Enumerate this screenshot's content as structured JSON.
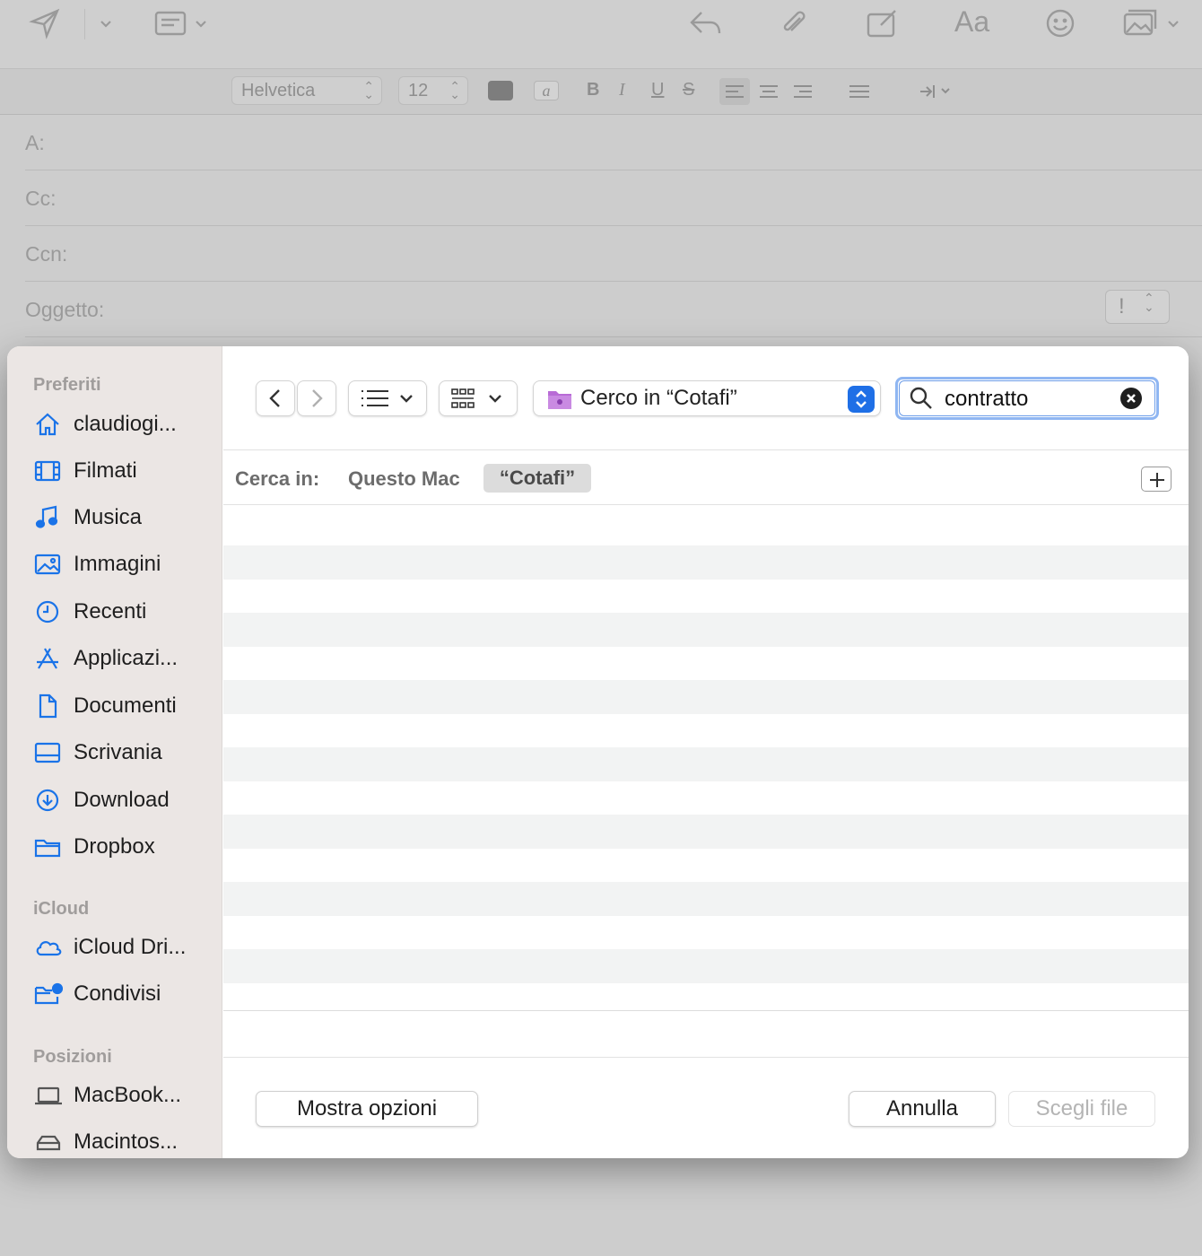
{
  "mail": {
    "toolbar": {
      "icons": [
        "send-icon",
        "chevron-down-icon",
        "header-fields-icon",
        "reply-icon",
        "attachment-icon",
        "markup-icon",
        "font-icon",
        "emoji-icon",
        "photo-browser-icon"
      ],
      "font_label": "Aa"
    },
    "format_bar": {
      "font_name": "Helvetica",
      "font_size": "12",
      "bold": "B",
      "italic": "I",
      "underline": "U",
      "strike": "S",
      "bg_color_glyph": "a"
    },
    "fields": {
      "to_label": "A:",
      "cc_label": "Cc:",
      "bcc_label": "Ccn:",
      "subject_label": "Oggetto:",
      "priority_glyph": "!"
    }
  },
  "dialog": {
    "sidebar": {
      "favorites_title": "Preferiti",
      "favorites": [
        {
          "label": "claudiogi...",
          "icon": "home-icon"
        },
        {
          "label": "Filmati",
          "icon": "film-icon"
        },
        {
          "label": "Musica",
          "icon": "music-note-icon"
        },
        {
          "label": "Immagini",
          "icon": "photo-icon"
        },
        {
          "label": "Recenti",
          "icon": "clock-icon"
        },
        {
          "label": "Applicazi...",
          "icon": "apps-icon"
        },
        {
          "label": "Documenti",
          "icon": "document-icon"
        },
        {
          "label": "Scrivania",
          "icon": "desktop-icon"
        },
        {
          "label": "Download",
          "icon": "download-icon"
        },
        {
          "label": "Dropbox",
          "icon": "folder-icon"
        }
      ],
      "icloud_title": "iCloud",
      "icloud": [
        {
          "label": "iCloud Dri...",
          "icon": "cloud-icon"
        },
        {
          "label": "Condivisi",
          "icon": "shared-folder-icon"
        }
      ],
      "locations_title": "Posizioni",
      "locations": [
        {
          "label": "MacBook...",
          "icon": "laptop-icon"
        },
        {
          "label": "Macintos...",
          "icon": "disk-icon"
        }
      ]
    },
    "navbar": {
      "location_label": "Cerco in “Cotafi”",
      "search_value": "contratto",
      "accent": "#1f6fe6",
      "folder_color": "#b86bd6"
    },
    "scope": {
      "label": "Cerca in:",
      "this_mac": "Questo Mac",
      "folder": "“Cotafi”"
    },
    "buttons": {
      "options": "Mostra opzioni",
      "cancel": "Annulla",
      "choose": "Scegli file"
    }
  }
}
